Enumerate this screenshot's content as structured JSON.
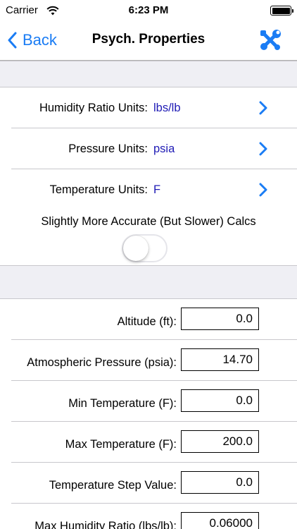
{
  "status_bar": {
    "carrier": "Carrier",
    "time": "6:23 PM"
  },
  "nav": {
    "back_label": "Back",
    "title": "Psych. Properties",
    "right_icon": "tools-icon",
    "accent_color": "#1a7cf4"
  },
  "unit_rows": [
    {
      "label": "Humidity Ratio Units:",
      "value": "lbs/lb"
    },
    {
      "label": "Pressure Units:",
      "value": "psia"
    },
    {
      "label": "Temperature Units:",
      "value": "F"
    }
  ],
  "accurate_calcs": {
    "label": "Slightly More Accurate (But Slower) Calcs",
    "enabled": false
  },
  "fields": [
    {
      "label": "Altitude (ft):",
      "value": "0.0"
    },
    {
      "label": "Atmospheric Pressure (psia):",
      "value": "14.70"
    },
    {
      "label": "Min Temperature (F):",
      "value": "0.0"
    },
    {
      "label": "Max Temperature (F):",
      "value": "200.0"
    },
    {
      "label": "Temperature Step Value:",
      "value": "0.0"
    },
    {
      "label": "Max Humidity Ratio (lbs/lb):",
      "value": "0.06000"
    }
  ]
}
